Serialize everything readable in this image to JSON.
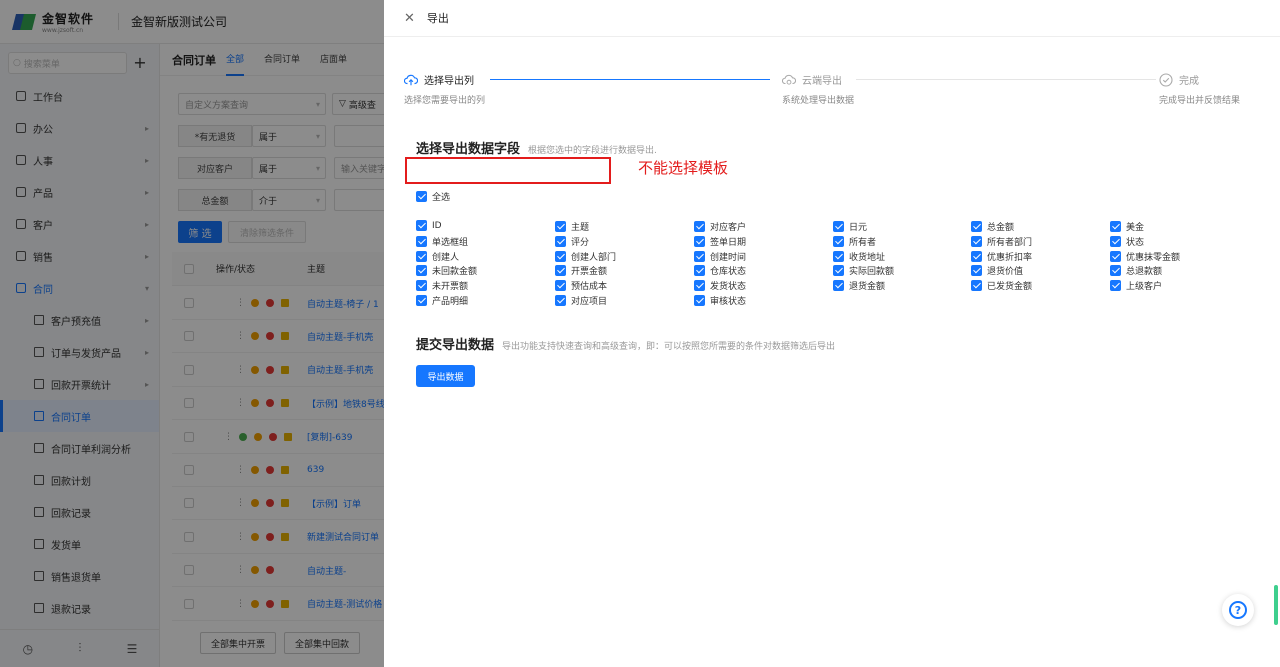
{
  "app": {
    "logo_text": "金智软件",
    "logo_url": "www.jzsoft.cn",
    "company": "金智新版测试公司"
  },
  "sidebar": {
    "search_placeholder": "搜索菜单",
    "items": [
      {
        "label": "工作台"
      },
      {
        "label": "办公"
      },
      {
        "label": "人事"
      },
      {
        "label": "产品"
      },
      {
        "label": "客户"
      },
      {
        "label": "销售"
      },
      {
        "label": "合同"
      },
      {
        "label": "客户预充值"
      },
      {
        "label": "订单与发货产品"
      },
      {
        "label": "回款开票统计"
      },
      {
        "label": "合同订单"
      },
      {
        "label": "合同订单利润分析"
      },
      {
        "label": "回款计划"
      },
      {
        "label": "回款记录"
      },
      {
        "label": "发货单"
      },
      {
        "label": "销售退货单"
      },
      {
        "label": "退款记录"
      }
    ],
    "footer_icons": [
      "history-icon",
      "filter-settings-icon",
      "collapse-menu-icon"
    ]
  },
  "main": {
    "title": "合同订单",
    "tabs": [
      "全部",
      "合同订单",
      "店面单"
    ],
    "scheme_placeholder": "自定义方案查询",
    "advanced": "高级查",
    "filters": [
      {
        "label": "*有无退货",
        "op": "属于",
        "value": ""
      },
      {
        "label": "对应客户",
        "op": "属于",
        "value": "输入关键字"
      },
      {
        "label": "总金额",
        "op": "介于",
        "value": ""
      }
    ],
    "filter_btn": "筛 选",
    "clear_btn": "清除筛选条件",
    "columns": [
      "操作/状态",
      "主题"
    ],
    "rows": [
      {
        "title": "自动主题-椅子 / 1"
      },
      {
        "title": "自动主题-手机壳"
      },
      {
        "title": "自动主题-手机壳"
      },
      {
        "title": "【示例】地铁8号线"
      },
      {
        "title": "[复制]-639"
      },
      {
        "title": "639"
      },
      {
        "title": "【示例】订单"
      },
      {
        "title": "新建测试合同订单"
      },
      {
        "title": "自动主题-"
      },
      {
        "title": "自动主题-测试价格"
      }
    ],
    "bottom_buttons": [
      "全部集中开票",
      "全部集中回款"
    ]
  },
  "drawer": {
    "title": "导出",
    "steps": [
      {
        "title": "选择导出列",
        "desc": "选择您需要导出的列"
      },
      {
        "title": "云端导出",
        "desc": "系统处理导出数据"
      },
      {
        "title": "完成",
        "desc": "完成导出并反馈结果"
      }
    ],
    "section1": {
      "title": "选择导出数据字段",
      "subtitle": "根据您选中的字段进行数据导出."
    },
    "annotation": "不能选择模板",
    "select_all": "全选",
    "fields": [
      [
        "ID",
        "主题",
        "对应客户",
        "日元",
        "总金额",
        "美金"
      ],
      [
        "单选框组",
        "评分",
        "签单日期",
        "所有者",
        "所有者部门",
        "状态"
      ],
      [
        "创建人",
        "创建人部门",
        "创建时间",
        "收货地址",
        "优惠折扣率",
        "优惠抹零金额"
      ],
      [
        "未回款金额",
        "开票金额",
        "仓库状态",
        "实际回款额",
        "退货价值",
        "总退款额"
      ],
      [
        "未开票额",
        "预估成本",
        "发货状态",
        "退货金额",
        "已发货金额",
        "上级客户"
      ],
      [
        "产品明细",
        "对应项目",
        "审核状态"
      ]
    ],
    "section2": {
      "title": "提交导出数据",
      "subtitle": "导出功能支持快速查询和高级查询，即：可以按照您所需要的条件对数据筛选后导出"
    },
    "export_btn": "导出数据",
    "help": "?"
  },
  "colors": {
    "primary": "#1677ff",
    "annotation_red": "#e31c1c",
    "overlay": "rgba(0,0,0,0.45)"
  }
}
